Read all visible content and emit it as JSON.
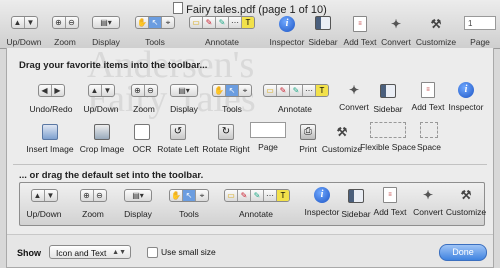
{
  "window": {
    "title": "Fairy tales.pdf (page 1 of 10)"
  },
  "toolbar": {
    "items": [
      "Up/Down",
      "Zoom",
      "Display",
      "Tools",
      "Annotate",
      "Inspector",
      "Sidebar",
      "Add Text",
      "Convert",
      "Customize",
      "Page"
    ],
    "page_value": "1"
  },
  "sheet": {
    "heading_top": "Drag your favorite items into the toolbar...",
    "heading_default": "... or drag the default set into the toolbar.",
    "background_text": [
      "Andersen's",
      "Fairy Tales"
    ],
    "palette_row1": [
      "Undo/Redo",
      "Up/Down",
      "Zoom",
      "Display",
      "Tools",
      "Annotate",
      "Convert",
      "Sidebar",
      "Add Text",
      "Inspector"
    ],
    "palette_row2": [
      "Insert Image",
      "Crop Image",
      "OCR",
      "Rotate Left",
      "Rotate Right",
      "Page",
      "Print",
      "Customize",
      "Flexible Space",
      "Space"
    ],
    "default_set": [
      "Up/Down",
      "Zoom",
      "Display",
      "Tools",
      "Annotate",
      "Inspector",
      "Sidebar",
      "Add Text",
      "Convert",
      "Customize"
    ]
  },
  "footer": {
    "show_label": "Show",
    "show_value": "Icon and Text",
    "small_size_label": "Use small size",
    "done_label": "Done"
  },
  "colors": {
    "accent": "#3f83e0",
    "selected_segment": "#6b9de0"
  }
}
